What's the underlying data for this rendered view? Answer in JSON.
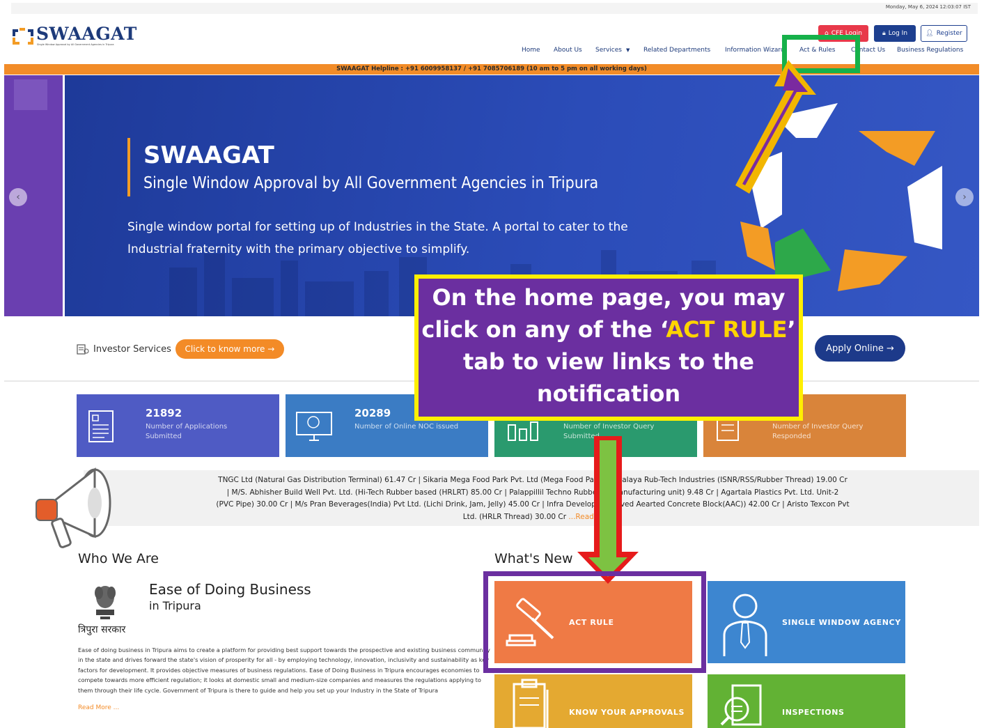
{
  "topbar": {
    "datetime": "Monday, May 6, 2024 12:03:07 IST"
  },
  "logo": {
    "text": "SWAAGAT",
    "tagline": "Single Window Approval by All Government Agencies in Tripura"
  },
  "header_buttons": {
    "cfe": "CFE Login",
    "login": "Log In",
    "register": "Register"
  },
  "nav": {
    "items": [
      "Home",
      "About Us",
      "Services",
      "Related Departments",
      "Information Wizard",
      "Act & Rules",
      "Contact Us",
      "Business Regulations"
    ]
  },
  "helpline": "SWAAGAT Helpline : +91 6009958137 / +91 7085706189 (10 am to 5 pm on all working days)",
  "hero": {
    "title": "SWAAGAT",
    "subtitle": "Single Window Approval by All Government Agencies in Tripura",
    "description": "Single window portal for setting up of Industries in the State. A portal to cater to the Industrial fraternity with the primary objective to simplify."
  },
  "investor": {
    "label": "Investor Services",
    "cta": "Click to know more  →",
    "apply": "Apply Online  →"
  },
  "stats": [
    {
      "value": "21892",
      "label": "Number of Applications Submitted",
      "color": "#4f5bc4"
    },
    {
      "value": "20289",
      "label": "Number of Online NOC issued",
      "color": "#3b7cc4"
    },
    {
      "value": "",
      "label": "Number of Investor Query Submitted",
      "color": "#2a9a6e"
    },
    {
      "value": "",
      "label": "Number of Investor Query Responded",
      "color": "#d9843a"
    }
  ],
  "ticker": {
    "line1": "TNGC Ltd (Natural Gas Distribution Terminal) 61.47 Cr | Sikaria Mega Food Park Pvt. Ltd (Mega Food Park) ... Malaya Rub-Tech Industries (ISNR/RSS/Rubber Thread) 19.00 Cr",
    "line2": "| M/S. Abhisher Build Well Pvt. Ltd. (Hi-Tech Rubber based (HRLRT) 85.00 Cr | Palappillil Techno Rubber ... manufacturing unit) 9.48 Cr | Agartala Plastics Pvt. Ltd. Unit-2",
    "line3": "(PVC Pipe) 30.00 Cr | M/s Pran Beverages(India) Pvt Ltd. (Lichi Drink, Jam, Jelly) 45.00 Cr | Infra Develope... claved Aearted Concrete Block(AAC)) 42.00 Cr | Aristo Texcon Pvt",
    "line4": "Ltd. (HRLR Thread) 30.00 Cr",
    "more": "...Read M"
  },
  "who": {
    "heading": "Who We Are",
    "hindi": "त्रिपुरा सरकार",
    "title": "Ease of Doing Business",
    "subtitle": "in Tripura",
    "body": "Ease of doing business in Tripura aims to create a platform for providing best support towards the prospective and existing business community in the state and drives forward the state's vision of prosperity for all - by employing technology, innovation, inclusivity and sustainability as key factors for development. It provides objective measures of business regulations. Ease of Doing Business in Tripura encourages economies to compete towards more efficient regulation; it looks at domestic small and medium-size companies and measures the regulations applying to them through their life cycle. Government of Tripura is there to guide and help you set up your Industry in the State of Tripura",
    "read_more": "Read More ..."
  },
  "whats_new": {
    "heading": "What's New",
    "tiles": [
      {
        "label": "ACT RULE",
        "color": "#ef7a45"
      },
      {
        "label": "SINGLE WINDOW AGENCY",
        "color": "#3d86d0"
      },
      {
        "label": "KNOW YOUR APPROVALS",
        "color": "#e4a931"
      },
      {
        "label": "INSPECTIONS",
        "color": "#62b234"
      }
    ]
  },
  "callout": {
    "line1": "On the home page, you may",
    "line2_pre": "click on any of the ‘",
    "line2_hl": "ACT RULE",
    "line2_post": "’",
    "line3": "tab to view links to the",
    "line4": "notification"
  },
  "colors": {
    "brand_navy": "#1d3a7a",
    "accent_orange": "#f38b27",
    "callout_purple": "#6b2fa0",
    "callout_border": "#ffef00",
    "highlight_green": "#16b14a",
    "arrow_red": "#e61b1b"
  }
}
